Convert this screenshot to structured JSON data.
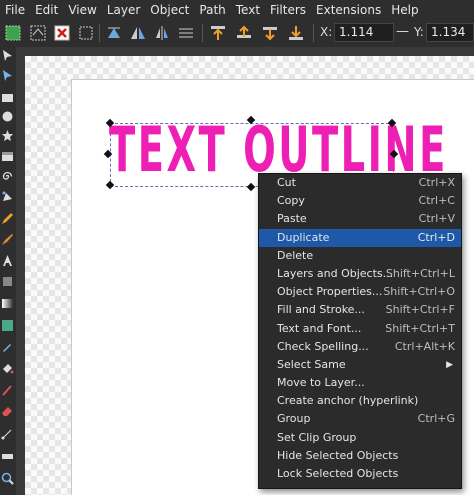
{
  "menubar": [
    "File",
    "Edit",
    "View",
    "Layer",
    "Object",
    "Path",
    "Text",
    "Filters",
    "Extensions",
    "Help"
  ],
  "toolbar": {
    "x_label": "X:",
    "x_value": "1.114",
    "y_label": "Y:",
    "y_value": "1.134",
    "minus": "—"
  },
  "canvas": {
    "text": "TEXT OUTLINE",
    "text_color": "#ee1fb4"
  },
  "context_menu": {
    "items": [
      {
        "label": "Cut",
        "shortcut": "Ctrl+X"
      },
      {
        "label": "Copy",
        "shortcut": "Ctrl+C"
      },
      {
        "label": "Paste",
        "shortcut": "Ctrl+V"
      },
      {
        "label": "Duplicate",
        "shortcut": "Ctrl+D"
      },
      {
        "label": "Delete",
        "shortcut": ""
      },
      {
        "label": "Layers and Objects...",
        "shortcut": "Shift+Ctrl+L"
      },
      {
        "label": "Object Properties...",
        "shortcut": "Shift+Ctrl+O"
      },
      {
        "label": "Fill and Stroke...",
        "shortcut": "Shift+Ctrl+F"
      },
      {
        "label": "Text and Font...",
        "shortcut": "Shift+Ctrl+T"
      },
      {
        "label": "Check Spelling...",
        "shortcut": "Ctrl+Alt+K"
      },
      {
        "label": "Select Same",
        "shortcut": ""
      },
      {
        "label": "Move to Layer...",
        "shortcut": ""
      },
      {
        "label": "Create anchor (hyperlink)",
        "shortcut": ""
      },
      {
        "label": "Group",
        "shortcut": "Ctrl+G"
      },
      {
        "label": "Set Clip Group",
        "shortcut": ""
      },
      {
        "label": "Hide Selected Objects",
        "shortcut": ""
      },
      {
        "label": "Lock Selected Objects",
        "shortcut": ""
      }
    ],
    "highlighted": "Duplicate",
    "highlight_color": "#1e58a8"
  }
}
